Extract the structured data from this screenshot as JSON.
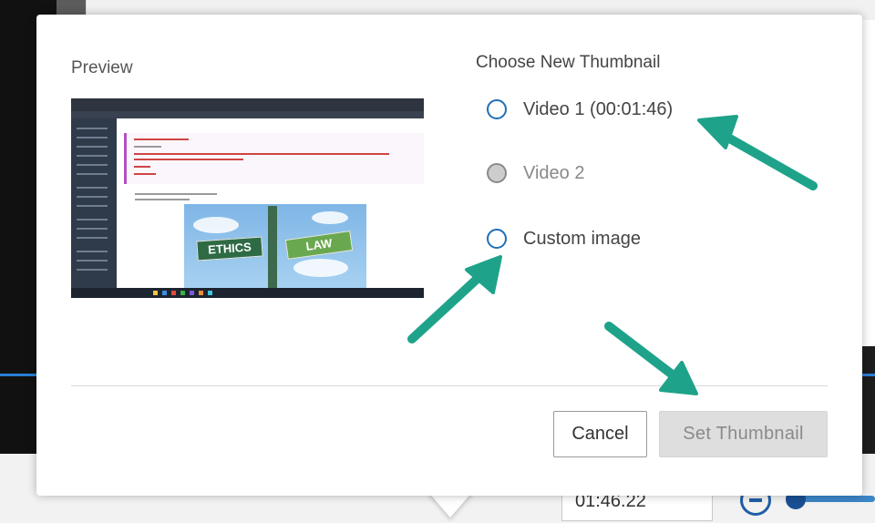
{
  "dialog": {
    "preview_label": "Preview",
    "choose_label": "Choose New Thumbnail",
    "options": [
      {
        "label": "Video 1 (00:01:46)",
        "state": "enabled"
      },
      {
        "label": "Video 2",
        "state": "disabled"
      },
      {
        "label": "Custom image",
        "state": "enabled"
      }
    ],
    "cancel_label": "Cancel",
    "set_thumbnail_label": "Set Thumbnail"
  },
  "preview_image": {
    "sign_left": "ETHICS",
    "sign_right": "LAW"
  },
  "player": {
    "time_value": "01:46.22"
  },
  "icons": {
    "zoom_out": "zoom-out-icon",
    "annotation": "arrow-annotation"
  },
  "colors": {
    "accent_blue": "#1f6fb5",
    "annotation_arrow": "#1ea38a",
    "disabled_button_bg": "#dedede"
  }
}
